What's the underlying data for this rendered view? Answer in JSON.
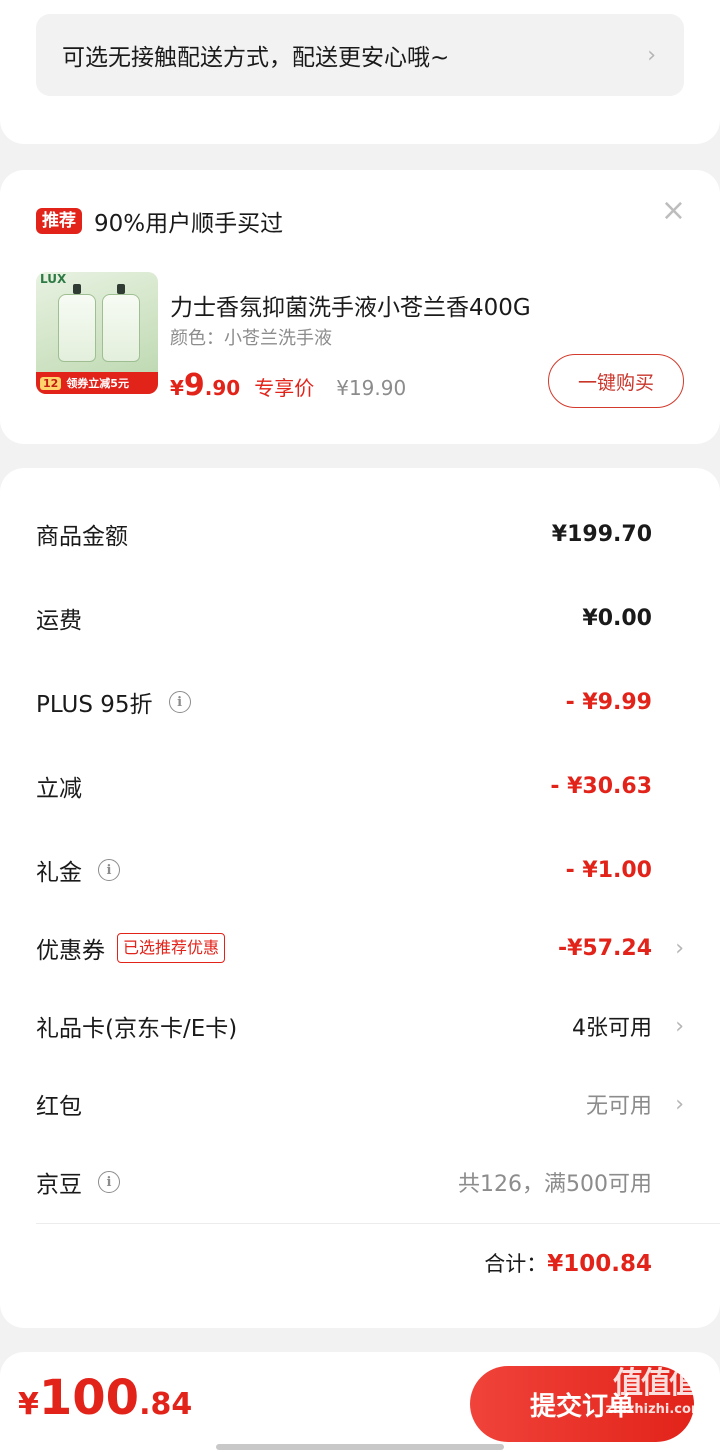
{
  "delivery": {
    "text": "可选无接触配送方式，配送更安心哦~"
  },
  "recommend": {
    "tag": "推荐",
    "title": "90%用户顺手买过",
    "close_glyph": "×",
    "thumbnail": {
      "brand": "LUX",
      "promo_num": "12",
      "promo_text": "领券立减5元"
    },
    "product": {
      "name": "力士香氛抑菌洗手液小苍兰香400G",
      "color": "颜色：小苍兰洗手液",
      "price_symbol": "¥",
      "price_int": "9",
      "price_dec": ".90",
      "exclusive_label": "专享价",
      "original_price": "¥19.90"
    },
    "buy_button": "一键购买"
  },
  "summary": {
    "rows": [
      {
        "label": "商品金额",
        "value": "¥199.70"
      },
      {
        "label": "运费",
        "value": "¥0.00"
      },
      {
        "label": "PLUS 95折",
        "value": "- ¥9.99"
      },
      {
        "label": "立减",
        "value": "- ¥30.63"
      },
      {
        "label": "礼金",
        "value": "- ¥1.00"
      },
      {
        "label": "优惠券",
        "tag": "已选推荐优惠",
        "value": "-¥57.24"
      },
      {
        "label": "礼品卡(京东卡/E卡)",
        "value": "4张可用"
      },
      {
        "label": "红包",
        "value": "无可用"
      },
      {
        "label": "京豆",
        "value": "共126，满500可用"
      }
    ],
    "total_label": "合计：",
    "total_value": "¥100.84"
  },
  "bottom": {
    "pay_symbol": "¥",
    "pay_int": "100",
    "pay_dec": ".84",
    "submit": "提交订单"
  },
  "watermark": {
    "main": "值值值",
    "sub": "zhizhizhi.com"
  },
  "colors": {
    "accent": "#e2231a",
    "background": "#f2f2f2",
    "muted": "#8c8c8c"
  },
  "icons": [
    "chevron-right-icon",
    "close-icon",
    "info-icon"
  ]
}
